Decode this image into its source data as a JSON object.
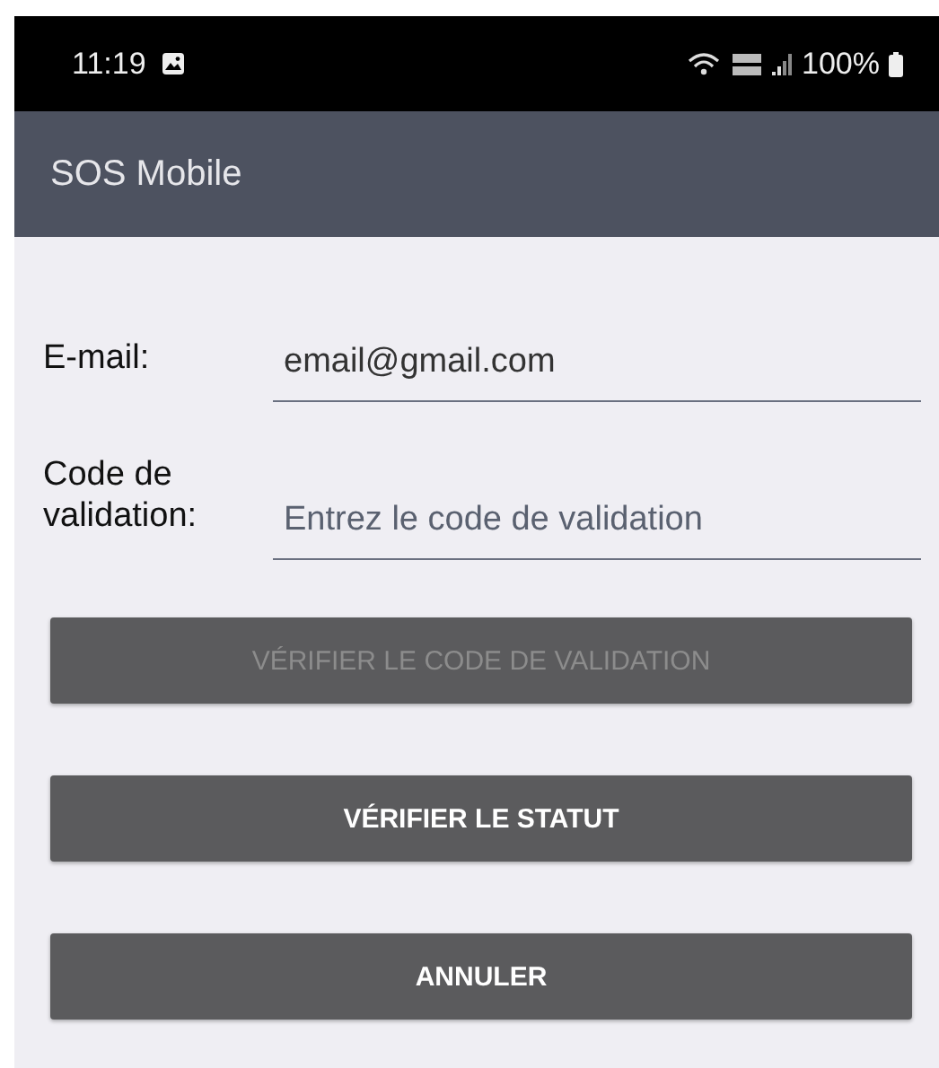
{
  "status_bar": {
    "time": "11:19",
    "battery": "100%"
  },
  "app_bar": {
    "title": "SOS Mobile"
  },
  "fields": [
    {
      "label": "E-mail:",
      "value": "email@gmail.com"
    },
    {
      "label": "Code de validation:",
      "placeholder": "Entrez le code de validation"
    }
  ],
  "buttons": [
    {
      "label": "VÉRIFIER LE CODE DE VALIDATION",
      "disabled": true
    },
    {
      "label": "VÉRIFIER LE STATUT",
      "disabled": false
    },
    {
      "label": "ANNULER",
      "disabled": false
    }
  ]
}
